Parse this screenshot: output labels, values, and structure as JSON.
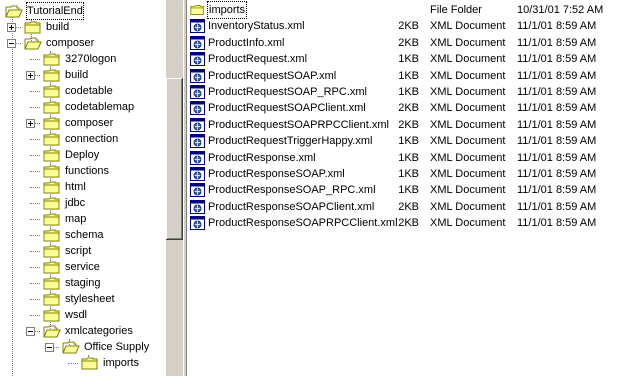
{
  "tree": {
    "items": [
      {
        "label": "TutorialEnd",
        "expander": "minus"
      },
      {
        "label": "build",
        "expander": "plus"
      },
      {
        "label": "composer",
        "expander": "minus"
      },
      {
        "label": "3270logon",
        "expander": ""
      },
      {
        "label": "build",
        "expander": "plus"
      },
      {
        "label": "codetable",
        "expander": ""
      },
      {
        "label": "codetablemap",
        "expander": ""
      },
      {
        "label": "composer",
        "expander": "plus"
      },
      {
        "label": "connection",
        "expander": ""
      },
      {
        "label": "Deploy",
        "expander": ""
      },
      {
        "label": "functions",
        "expander": ""
      },
      {
        "label": "html",
        "expander": ""
      },
      {
        "label": "jdbc",
        "expander": ""
      },
      {
        "label": "map",
        "expander": ""
      },
      {
        "label": "schema",
        "expander": ""
      },
      {
        "label": "script",
        "expander": ""
      },
      {
        "label": "service",
        "expander": ""
      },
      {
        "label": "staging",
        "expander": ""
      },
      {
        "label": "stylesheet",
        "expander": ""
      },
      {
        "label": "wsdl",
        "expander": ""
      },
      {
        "label": "xmlcategories",
        "expander": "minus"
      },
      {
        "label": "Office Supply",
        "expander": "minus"
      },
      {
        "label": "imports",
        "expander": ""
      }
    ]
  },
  "files": [
    {
      "name": "imports",
      "size": "",
      "type": "File Folder",
      "modified": "10/31/01 7:52 AM",
      "icon": "folder-icon"
    },
    {
      "name": "InventoryStatus.xml",
      "size": "2KB",
      "type": "XML Document",
      "modified": "11/1/01 8:59 AM",
      "icon": "xml-document-icon"
    },
    {
      "name": "ProductInfo.xml",
      "size": "2KB",
      "type": "XML Document",
      "modified": "11/1/01 8:59 AM",
      "icon": "xml-document-icon"
    },
    {
      "name": "ProductRequest.xml",
      "size": "1KB",
      "type": "XML Document",
      "modified": "11/1/01 8:59 AM",
      "icon": "xml-document-icon"
    },
    {
      "name": "ProductRequestSOAP.xml",
      "size": "1KB",
      "type": "XML Document",
      "modified": "11/1/01 8:59 AM",
      "icon": "xml-document-icon"
    },
    {
      "name": "ProductRequestSOAP_RPC.xml",
      "size": "1KB",
      "type": "XML Document",
      "modified": "11/1/01 8:59 AM",
      "icon": "xml-document-icon"
    },
    {
      "name": "ProductRequestSOAPClient.xml",
      "size": "2KB",
      "type": "XML Document",
      "modified": "11/1/01 8:59 AM",
      "icon": "xml-document-icon"
    },
    {
      "name": "ProductRequestSOAPRPCClient.xml",
      "size": "2KB",
      "type": "XML Document",
      "modified": "11/1/01 8:59 AM",
      "icon": "xml-document-icon"
    },
    {
      "name": "ProductRequestTriggerHappy.xml",
      "size": "1KB",
      "type": "XML Document",
      "modified": "11/1/01 8:59 AM",
      "icon": "xml-document-icon"
    },
    {
      "name": "ProductResponse.xml",
      "size": "1KB",
      "type": "XML Document",
      "modified": "11/1/01 8:59 AM",
      "icon": "xml-document-icon"
    },
    {
      "name": "ProductResponseSOAP.xml",
      "size": "1KB",
      "type": "XML Document",
      "modified": "11/1/01 8:59 AM",
      "icon": "xml-document-icon"
    },
    {
      "name": "ProductResponseSOAP_RPC.xml",
      "size": "1KB",
      "type": "XML Document",
      "modified": "11/1/01 8:59 AM",
      "icon": "xml-document-icon"
    },
    {
      "name": "ProductResponseSOAPClient.xml",
      "size": "2KB",
      "type": "XML Document",
      "modified": "11/1/01 8:59 AM",
      "icon": "xml-document-icon"
    },
    {
      "name": "ProductResponseSOAPRPCClient.xml",
      "size": "2KB",
      "type": "XML Document",
      "modified": "11/1/01 8:59 AM",
      "icon": "xml-document-icon"
    }
  ],
  "colors": {
    "folder": "#ffff99",
    "folder_edge": "#808000",
    "pane_bg": "#ffffff",
    "chrome": "#d4d0c8"
  }
}
